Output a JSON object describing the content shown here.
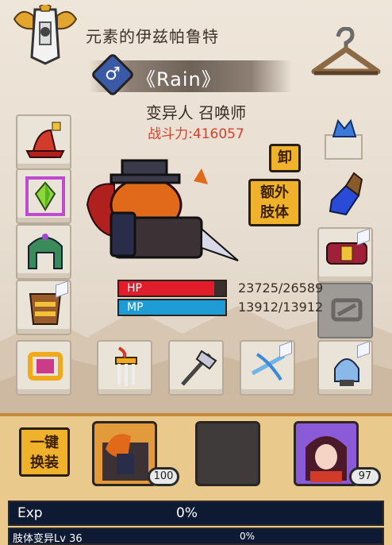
{
  "header": {
    "guild_name": "元素的伊兹帕鲁特",
    "player_name": "《Rain》",
    "gender_symbol": "♂",
    "class_name": "变异人 召唤师",
    "power_label": "战斗力:",
    "power_value": "416057"
  },
  "buttons": {
    "unequip": "卸",
    "extra_limb_line1": "额外",
    "extra_limb_line2": "肢体",
    "one_key_line1": "一键",
    "one_key_line2": "换装"
  },
  "stats": {
    "hp_label": "HP",
    "hp_text": "23725/26589",
    "hp_fraction": 0.892,
    "mp_label": "MP",
    "mp_text": "13912/13912",
    "mp_fraction": 1.0,
    "hp_color": "#e21d2b",
    "mp_color": "#1e9cd6"
  },
  "pets": [
    {
      "level": "100"
    },
    {
      "level": ""
    },
    {
      "level": "97"
    }
  ],
  "exp": {
    "label": "Exp",
    "percent": "0%",
    "limb_label": "肢体变异Lv 36",
    "limb_percent": "0%"
  },
  "equipment_slots": [
    "hat-icon",
    "gem-icon",
    "helmet-icon",
    "armor-icon",
    "shield-icon",
    "gloves-icon",
    "belt-icon",
    "ring-icon",
    "ring-left-icon",
    "trident-icon",
    "axe-icon",
    "crossbow-icon",
    "lantern-icon"
  ]
}
